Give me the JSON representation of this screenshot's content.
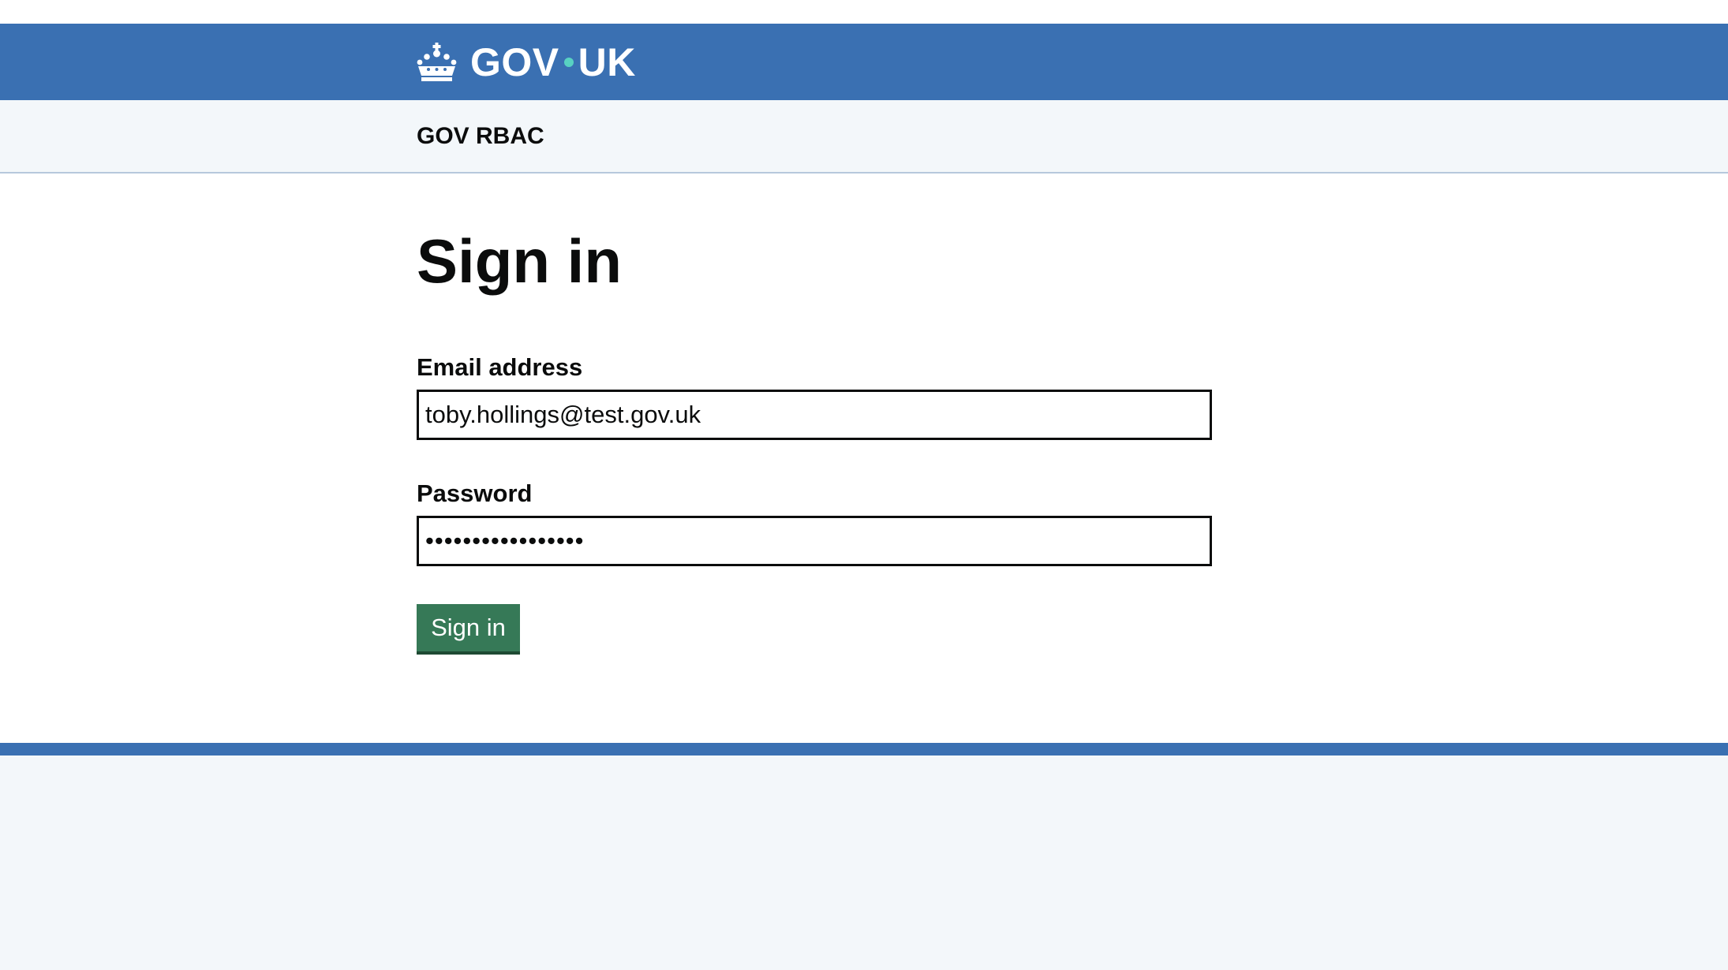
{
  "header": {
    "logo_text_left": "GOV",
    "logo_text_right": "UK",
    "logo_icon": "crown-icon",
    "brand_color": "#3a70b2",
    "dot_color": "#58d2c2"
  },
  "service": {
    "name": "GOV RBAC"
  },
  "main": {
    "title": "Sign in",
    "email": {
      "label": "Email address",
      "value": "toby.hollings@test.gov.uk"
    },
    "password": {
      "label": "Password",
      "value": "•••••••••••••••••"
    },
    "submit_label": "Sign in",
    "button_color": "#367957"
  }
}
